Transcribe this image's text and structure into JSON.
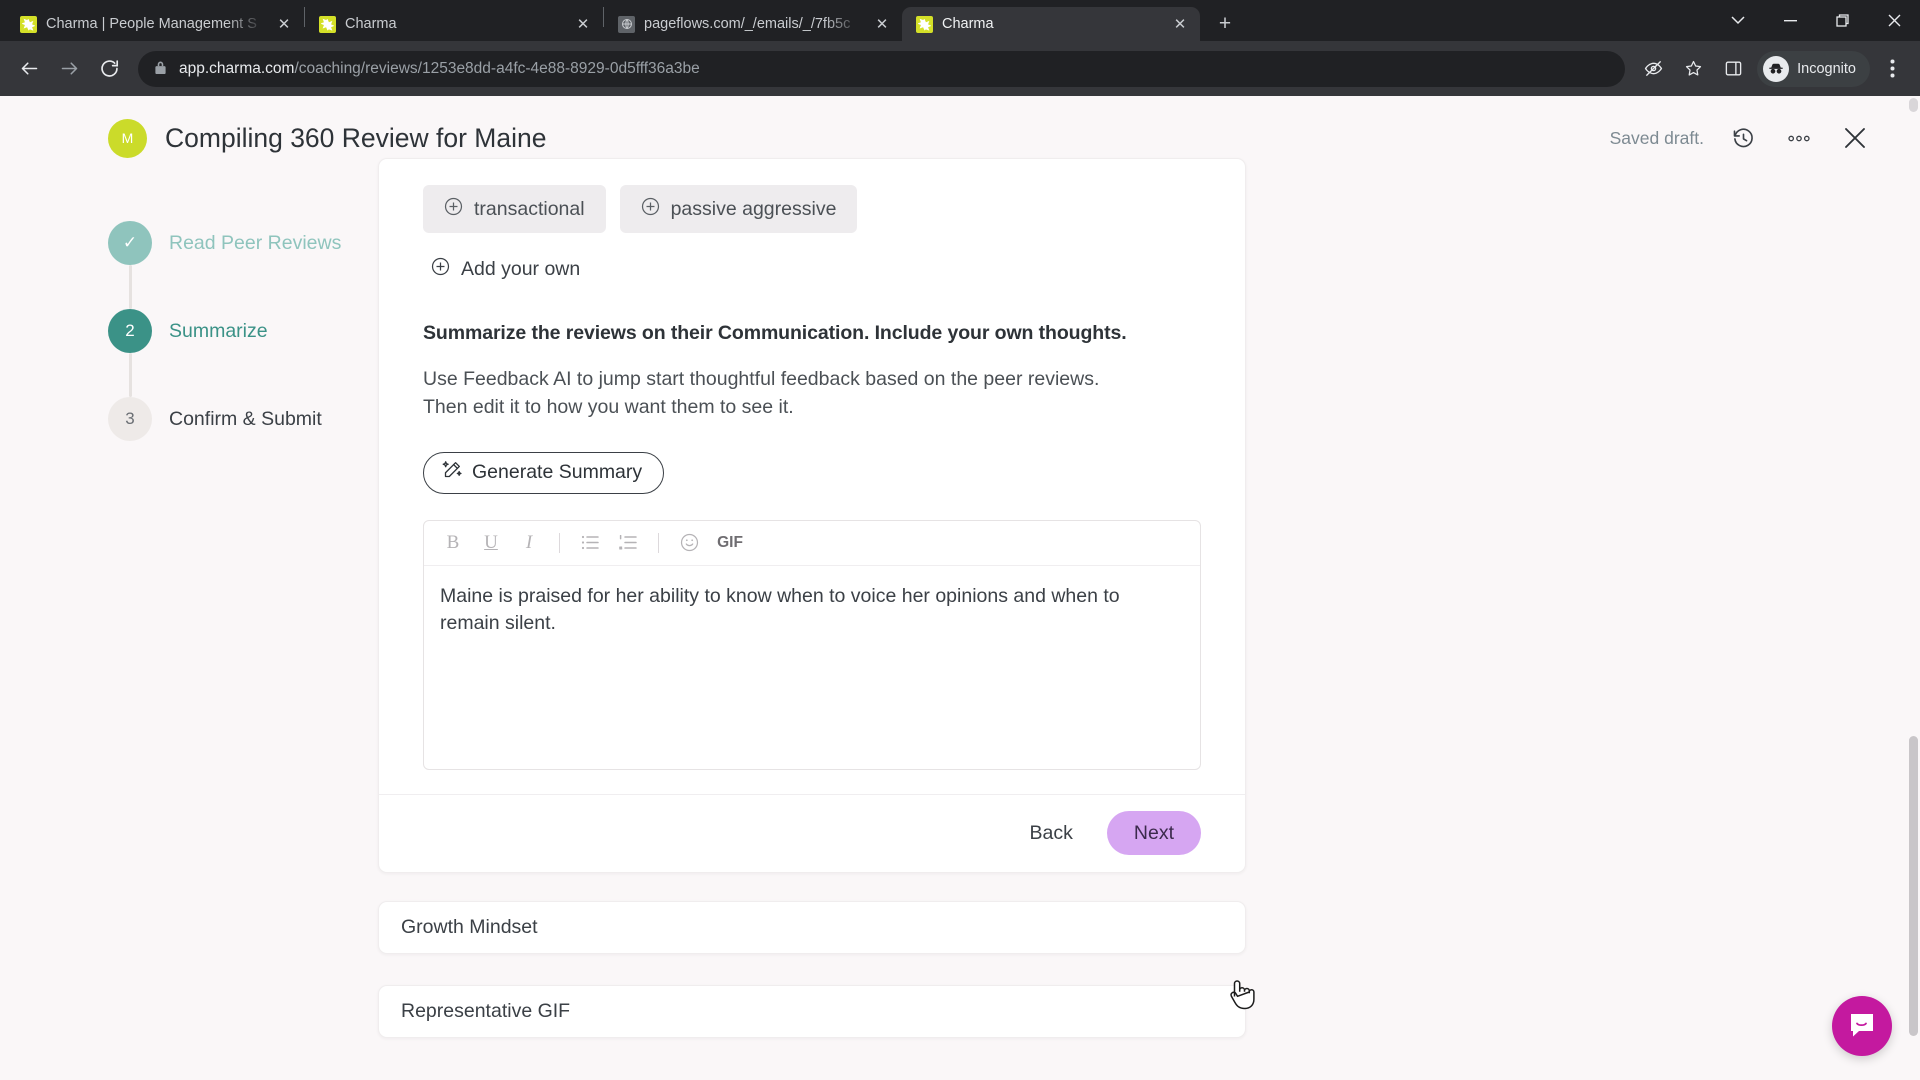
{
  "browser": {
    "tabs": [
      {
        "title": "Charma | People Management S",
        "favicon": "charma-star-icon",
        "active": false
      },
      {
        "title": "Charma",
        "favicon": "charma-star-icon",
        "active": false
      },
      {
        "title": "pageflows.com/_/emails/_/7fb5c",
        "favicon": "globe-icon",
        "active": false
      },
      {
        "title": "Charma",
        "favicon": "charma-star-icon",
        "active": true
      }
    ],
    "new_tab_label": "+",
    "window_controls": {
      "expand": "⌄",
      "minimize": "—",
      "maximize": "❐",
      "close": "✕"
    },
    "url": {
      "domain": "app.charma.com",
      "path": "/coaching/reviews/1253e8dd-a4fc-4e88-8929-0d5fff36a3be"
    },
    "profile_label": "Incognito"
  },
  "header": {
    "avatar_initial": "M",
    "title": "Compiling 360 Review for Maine",
    "status": "Saved draft.",
    "icons": {
      "history": "history-icon",
      "more": "more-options-icon",
      "close": "close-icon"
    }
  },
  "stepper": {
    "steps": [
      {
        "marker": "✓",
        "label": "Read Peer Reviews",
        "state": "done"
      },
      {
        "marker": "2",
        "label": "Summarize",
        "state": "current"
      },
      {
        "marker": "3",
        "label": "Confirm & Submit",
        "state": "todo"
      }
    ]
  },
  "main": {
    "chips": [
      {
        "label": "transactional"
      },
      {
        "label": "passive aggressive"
      }
    ],
    "add_own_label": "Add your own",
    "prompt_question": "Summarize the reviews on their Communication. Include your own thoughts.",
    "prompt_help_line1": "Use Feedback AI to jump start thoughtful feedback based on the peer reviews.",
    "prompt_help_line2": "Then edit it to how you want them to see it.",
    "generate_button": "Generate Summary",
    "editor": {
      "toolbar": [
        {
          "name": "bold",
          "label": "B"
        },
        {
          "name": "underline",
          "label": "U"
        },
        {
          "name": "italic",
          "label": "I"
        },
        {
          "name": "bulleted-list",
          "label": ""
        },
        {
          "name": "numbered-list",
          "label": ""
        },
        {
          "name": "emoji",
          "label": ""
        },
        {
          "name": "gif",
          "label": "GIF"
        }
      ],
      "content": "Maine is praised for her ability to know when to voice her opinions and when to remain silent."
    },
    "back_button": "Back",
    "next_button": "Next",
    "collapsed_sections": [
      {
        "label": "Growth Mindset"
      },
      {
        "label": "Representative GIF"
      }
    ]
  },
  "support": {
    "widget": "intercom-chat-launcher"
  },
  "colors": {
    "accent_teal": "#3b9287",
    "accent_teal_light": "#8fc4bd",
    "next_button": "#d6a6f2",
    "avatar_green": "#cbdb2a",
    "intercom_magenta": "#c4199f",
    "page_background": "#faf7f8"
  }
}
